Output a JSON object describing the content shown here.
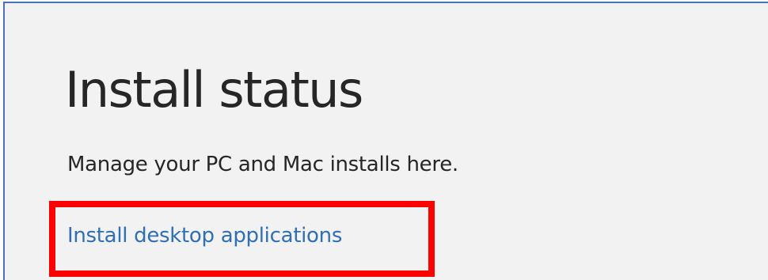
{
  "section": {
    "title": "Install status",
    "description": "Manage your PC and Mac installs here.",
    "install_link_label": "Install desktop applications"
  },
  "colors": {
    "panel_background": "#f2f2f2",
    "panel_border": "#4a72b5",
    "text": "#262626",
    "link": "#2f6fb5",
    "highlight": "#ff0000"
  }
}
